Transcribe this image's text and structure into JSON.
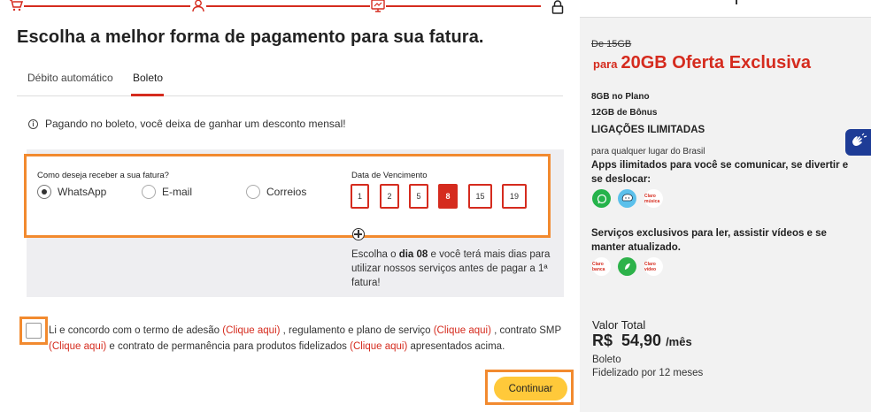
{
  "stepper": {
    "steps": [
      {
        "icon": "cart-icon"
      },
      {
        "icon": "user-icon"
      },
      {
        "icon": "payment-screen-icon"
      },
      {
        "icon": "lock-icon"
      }
    ],
    "color": "#d52b1e"
  },
  "main": {
    "title": "Escolha a melhor forma de pagamento para sua fatura.",
    "tabs": [
      {
        "label": "Débito automático",
        "active": false
      },
      {
        "label": "Boleto",
        "active": true
      }
    ],
    "info_icon": "i",
    "info_text": "Pagando no boleto, você deixa de ganhar um desconto mensal!",
    "receive": {
      "label": "Como deseja receber a sua fatura?",
      "options": [
        {
          "label": "WhatsApp",
          "checked": true
        },
        {
          "label": "E-mail",
          "checked": false
        },
        {
          "label": "Correios",
          "checked": false
        }
      ]
    },
    "due": {
      "label": "Data de Vencimento",
      "days": [
        "1",
        "2",
        "5",
        "8",
        "15",
        "19"
      ],
      "selected": "8",
      "note_pre": "Escolha o ",
      "note_bold": "dia 08",
      "note_post": " e você terá mais dias para utilizar nossos serviços antes de pagar a 1ª fatura!"
    },
    "terms": {
      "part1": "Li e concordo com o termo de adesão ",
      "link1": "(Clique aqui)",
      "part2": " , regulamento e plano de serviço ",
      "link2": "(Clique aqui)",
      "part3": " , contrato SMP ",
      "link3": "(Clique aqui)",
      "part4": " e contrato de permanência para produtos fidelizados ",
      "link4": "(Clique aqui)",
      "part5": " apresentados acima."
    },
    "continue_label": "Continuar",
    "accent": "#d52b1e",
    "highlight": "#f28a2f",
    "button_color": "#ffc93a"
  },
  "sidebar": {
    "old_price": "De 15GB",
    "offer_prefix": "para",
    "offer_main": "20GB Oferta Exclusiva",
    "plan_gb": "8GB no Plano",
    "bonus_gb": "12GB de Bônus",
    "calls_title": "LIGAÇÕES ILIMITADAS",
    "calls_sub": "para qualquer lugar do Brasil",
    "apps_text": "Apps ilimitados para você se comunicar, se divertir e se deslocar:",
    "apps": [
      {
        "icon": "whatsapp-icon",
        "color": "#25b34b"
      },
      {
        "icon": "waze-icon",
        "color": "#5bc0eb"
      },
      {
        "icon": "claro-musica-icon",
        "color": "#ffffff",
        "text": "Claro música"
      }
    ],
    "services_text": "Serviços exclusivos para ler, assistir vídeos e se manter atualizado.",
    "services": [
      {
        "icon": "claro-banca-icon",
        "color": "#ffffff",
        "text": "Claro banca"
      },
      {
        "icon": "globo-icon",
        "color": "#2db24a"
      },
      {
        "icon": "claro-video-icon",
        "color": "#ffffff",
        "text": "Claro vídeo"
      }
    ],
    "total_label": "Valor Total",
    "total_price": "R$  54,90",
    "total_per": "/mês",
    "total_method": "Boleto",
    "total_term": "Fidelizado por 12 meses"
  },
  "accessibility": {
    "icon": "sign-language-icon",
    "color": "#1e3c96"
  }
}
